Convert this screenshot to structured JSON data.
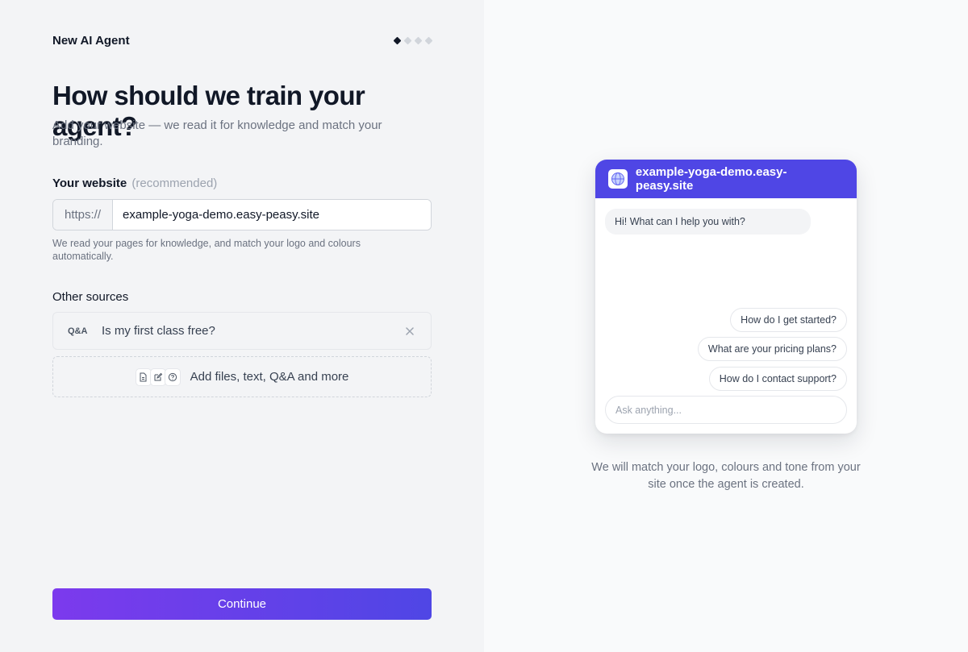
{
  "header": {
    "title": "New AI Agent",
    "steps": {
      "total": 4,
      "current": 1
    }
  },
  "main": {
    "heading": "How should we train your agent?",
    "subheading": "Add your website — we read it for knowledge and match your branding."
  },
  "website": {
    "label": "Your website",
    "label_hint": "(recommended)",
    "prefix": "https://",
    "value": "example-yoga-demo.easy-peasy.site",
    "help": "We read your pages for knowledge, and match your logo and colours automatically."
  },
  "sources": {
    "label": "Other sources",
    "items": [
      {
        "type": "Q&A",
        "text": "Is my first class free?"
      }
    ],
    "add_label": "Add files, text, Q&A and more"
  },
  "continue_label": "Continue",
  "preview": {
    "site": "example-yoga-demo.easy-peasy.site",
    "greeting": "Hi! What can I help you with?",
    "suggestions": [
      "How do I get started?",
      "What are your pricing plans?",
      "How do I contact support?"
    ],
    "input_placeholder": "Ask anything...",
    "caption": "We will match your logo, colours and tone from your site once the agent is created.",
    "brand_color": "#4f46e5"
  },
  "colors": {
    "primary_gradient_start": "#7c3aed",
    "primary_gradient_end": "#4f46e5"
  }
}
